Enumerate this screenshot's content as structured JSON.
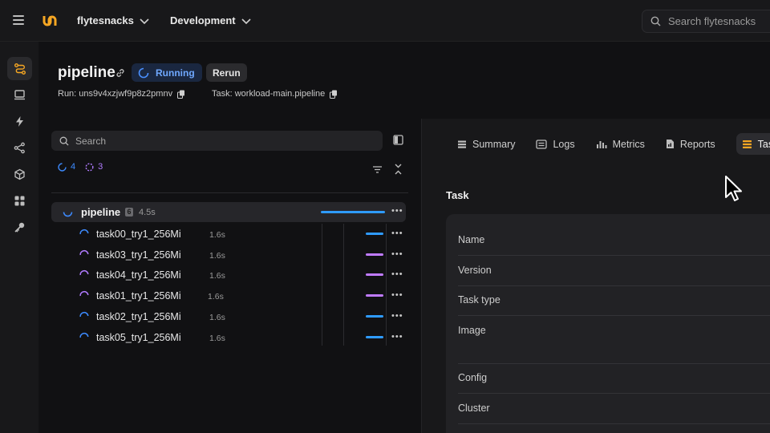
{
  "topbar": {
    "project": "flytesnacks",
    "domain": "Development",
    "search_placeholder": "Search flytesnacks"
  },
  "sidebar": {
    "items": [
      {
        "icon": "runs-icon",
        "active": true
      },
      {
        "icon": "monitor-icon",
        "active": false
      },
      {
        "icon": "bolt-icon",
        "active": false
      },
      {
        "icon": "share-icon",
        "active": false
      },
      {
        "icon": "cube-icon",
        "active": false
      },
      {
        "icon": "apps-icon",
        "active": false
      },
      {
        "icon": "key-icon",
        "active": false
      }
    ]
  },
  "header": {
    "title": "pipeline",
    "status": "Running",
    "rerun_label": "Rerun",
    "run_id": "Run: uns9v4xzjwf9p8z2pmnv",
    "task_name": "Task: workload-main.pipeline"
  },
  "left_panel": {
    "search_placeholder": "Search",
    "running_count": "4",
    "queued_count": "3",
    "root": {
      "name": "pipeline",
      "children_count": "6",
      "duration": "4.5s"
    },
    "rows": [
      {
        "name": "task00_try1_256Mi",
        "duration": "1.6s",
        "status": "running"
      },
      {
        "name": "task03_try1_256Mi",
        "duration": "1.6s",
        "status": "queued"
      },
      {
        "name": "task04_try1_256Mi",
        "duration": "1.6s",
        "status": "queued"
      },
      {
        "name": "task01_try1_256Mi",
        "duration": "1.6s",
        "status": "queued"
      },
      {
        "name": "task02_try1_256Mi",
        "duration": "1.6s",
        "status": "running"
      },
      {
        "name": "task05_try1_256Mi",
        "duration": "1.6s",
        "status": "running"
      }
    ]
  },
  "right_panel": {
    "tabs": [
      "Summary",
      "Logs",
      "Metrics",
      "Reports",
      "Task"
    ],
    "active_tab": "Task",
    "section_title": "Task",
    "fields": [
      "Name",
      "Version",
      "Task type",
      "Image",
      "Config",
      "Cluster"
    ]
  },
  "colors": {
    "running": "#3d8bff",
    "queued": "#b07bff",
    "running_bar": "#2f9bff",
    "queued_bar": "#c07bff",
    "brand": "#f5a623"
  }
}
